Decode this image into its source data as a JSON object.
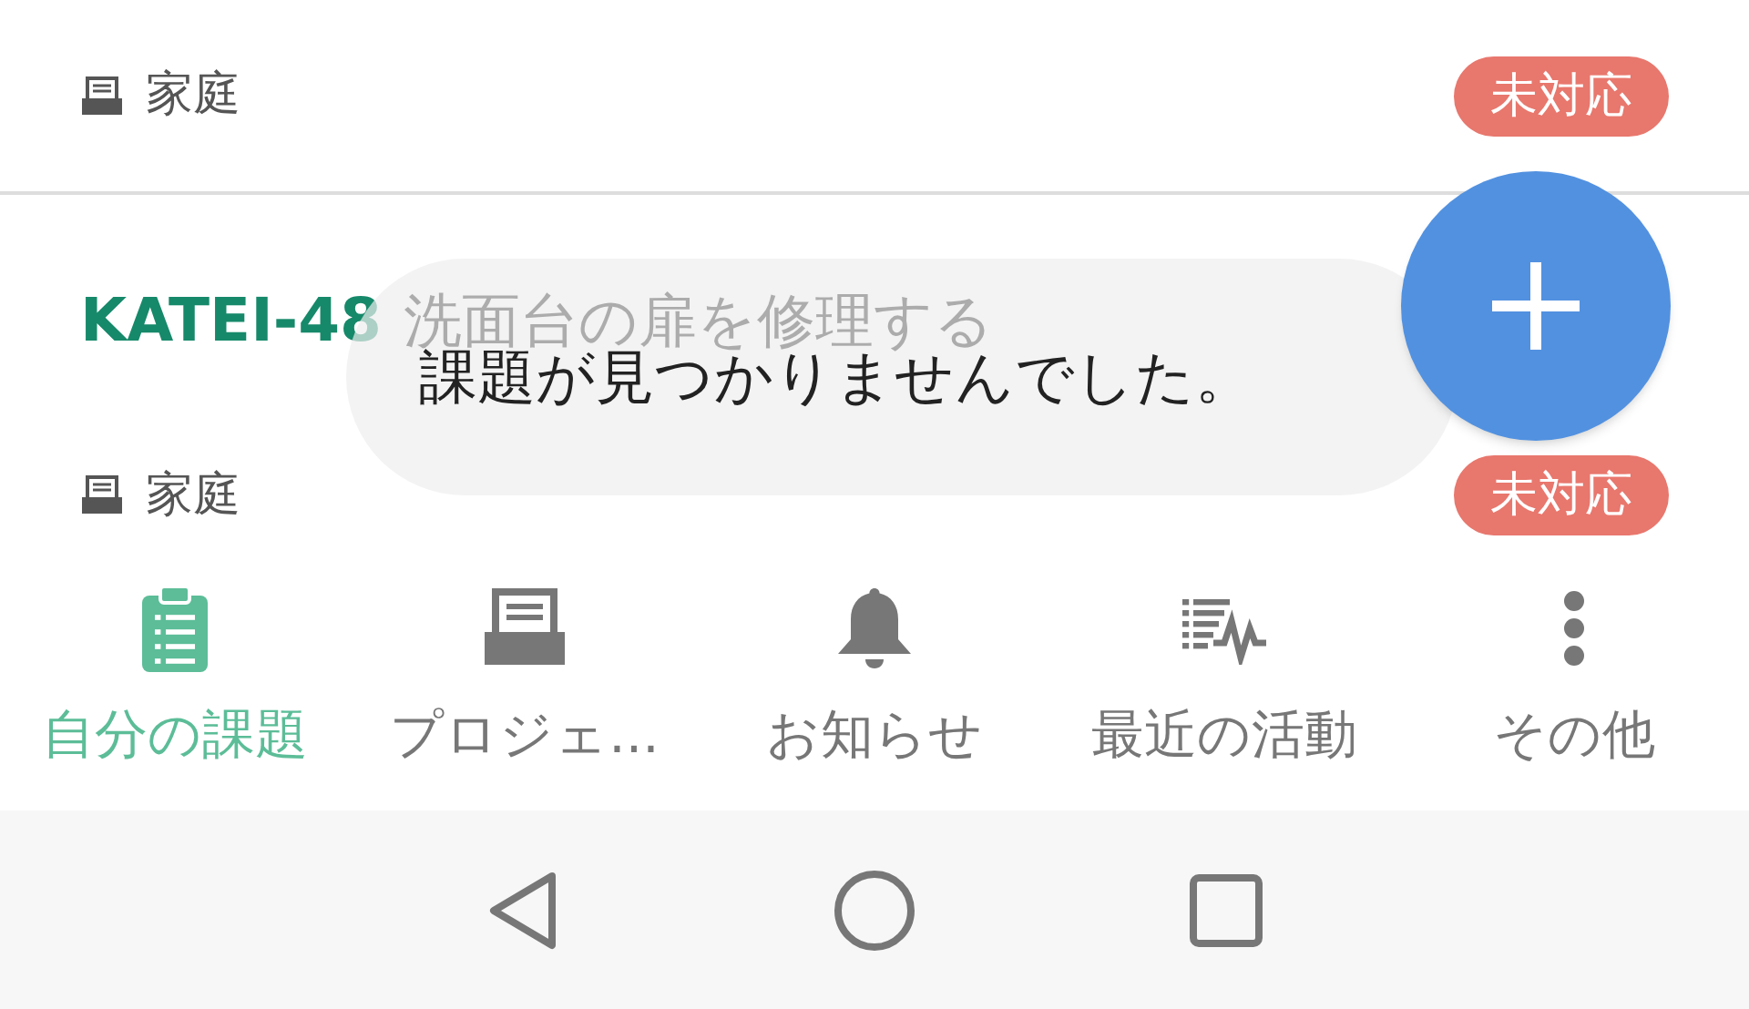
{
  "issues": [
    {
      "project": "家庭",
      "status": "未対応"
    },
    {
      "key": "KATEI-48",
      "summary": "洗面台の扉を修理する",
      "project": "家庭",
      "status": "未対応"
    }
  ],
  "toast": {
    "message": "課題が見つかりませんでした。"
  },
  "tabs": [
    {
      "kind": "clipboard",
      "label": "自分の課題",
      "selected": true
    },
    {
      "kind": "tray",
      "label": "プロジェ...",
      "selected": false
    },
    {
      "kind": "bell",
      "label": "お知らせ",
      "selected": false
    },
    {
      "kind": "activity",
      "label": "最近の活動",
      "selected": false
    },
    {
      "kind": "more",
      "label": "その他",
      "selected": false
    }
  ]
}
